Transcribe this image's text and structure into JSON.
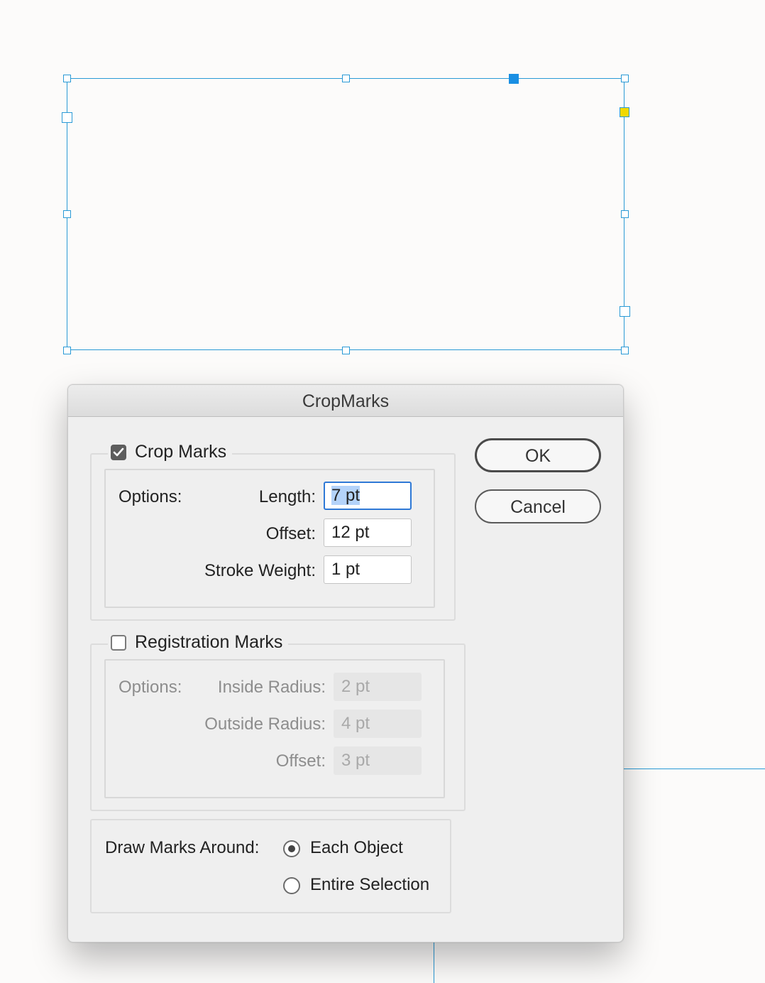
{
  "dialog": {
    "title": "CropMarks",
    "crop_marks": {
      "label": "Crop Marks",
      "checked": true,
      "options_label": "Options:",
      "length_label": "Length:",
      "length_value": "7 pt",
      "offset_label": "Offset:",
      "offset_value": "12 pt",
      "stroke_label": "Stroke Weight:",
      "stroke_value": "1 pt"
    },
    "registration_marks": {
      "label": "Registration Marks",
      "checked": false,
      "options_label": "Options:",
      "inside_label": "Inside Radius:",
      "inside_value": "2 pt",
      "outside_label": "Outside Radius:",
      "outside_value": "4 pt",
      "offset_label": "Offset:",
      "offset_value": "3 pt"
    },
    "draw_marks": {
      "label": "Draw Marks Around:",
      "options": [
        {
          "label": "Each Object",
          "selected": true
        },
        {
          "label": "Entire Selection",
          "selected": false
        }
      ]
    },
    "buttons": {
      "ok": "OK",
      "cancel": "Cancel"
    }
  },
  "colors": {
    "selection": "#2a9ad6",
    "focus": "#2f79d6",
    "text_highlight": "#b4d3fa",
    "anchor_handle": "#1a8fe3",
    "center_point": "#f2d900"
  }
}
